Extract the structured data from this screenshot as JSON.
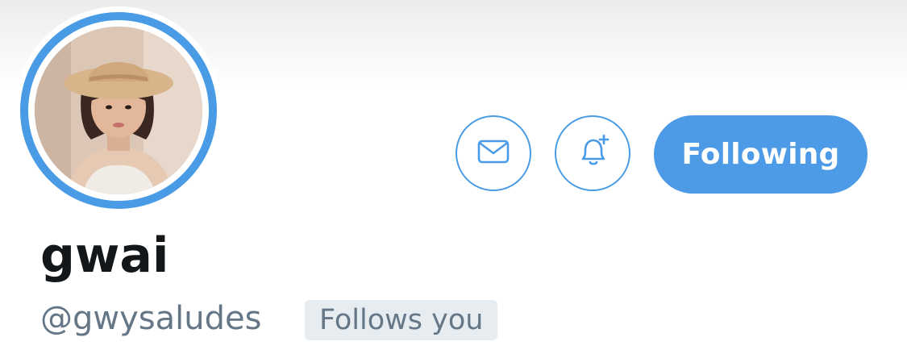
{
  "profile": {
    "display_name": "gwai",
    "handle": "@gwysaludes",
    "follows_you_label": "Follows you"
  },
  "actions": {
    "message_icon": "mail-icon",
    "notify_icon": "bell-plus-icon",
    "follow_label": "Following"
  },
  "colors": {
    "accent": "#4a9be6",
    "name": "#14171a",
    "secondary_text": "#657786",
    "badge_bg": "#e6ecf0"
  }
}
